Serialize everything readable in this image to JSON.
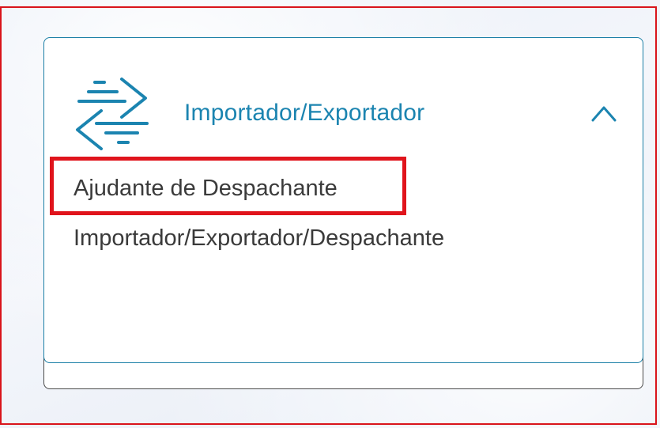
{
  "colors": {
    "accent": "#1b84b0",
    "card_border": "#1b7fa6",
    "highlight": "#e0141c",
    "text": "#3a3a3a"
  },
  "card": {
    "header": {
      "icon": "import-export-arrows-icon",
      "title": "Importador/Exportador",
      "collapse_icon": "chevron-up-icon"
    },
    "items": [
      {
        "label": "Ajudante de Despachante",
        "highlighted": true
      },
      {
        "label": "Importador/Exportador/Despachante",
        "highlighted": false
      }
    ]
  }
}
